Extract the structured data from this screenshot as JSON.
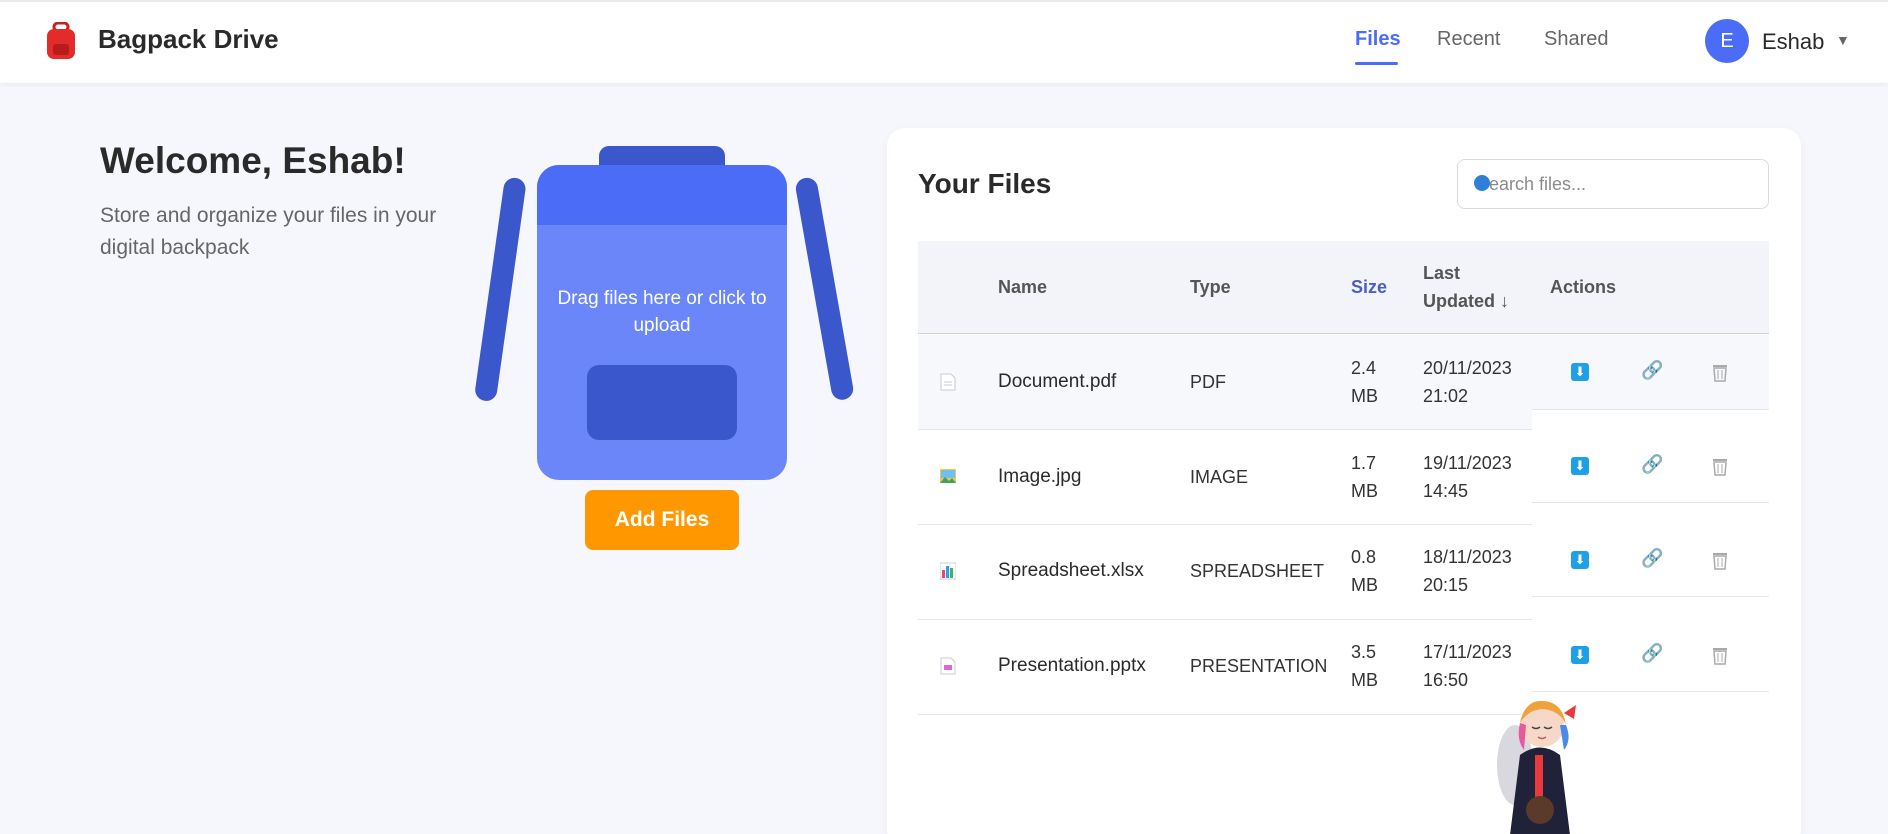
{
  "app": {
    "name": "Bagpack Drive"
  },
  "nav": {
    "items": [
      "Files",
      "Recent",
      "Shared"
    ],
    "active": "Files"
  },
  "user": {
    "initial": "E",
    "name": "Eshab"
  },
  "welcome": {
    "title": "Welcome, Eshab!",
    "subtitle": "Store and organize your files in your digital backpack"
  },
  "upload": {
    "drop_text": "Drag files here or click to upload",
    "button_label": "Add Files"
  },
  "files_panel": {
    "title": "Your Files",
    "search_placeholder": "Search files...",
    "columns": {
      "name": "Name",
      "type": "Type",
      "size": "Size",
      "last_updated_1": "Last",
      "last_updated_2": "Updated ↓",
      "actions": "Actions"
    },
    "rows": [
      {
        "icon": "pdf-file-icon",
        "name": "Document.pdf",
        "type": "PDF",
        "size_1": "2.4",
        "size_2": "MB",
        "date": "20/11/2023",
        "time": "21:02"
      },
      {
        "icon": "image-file-icon",
        "name": "Image.jpg",
        "type": "IMAGE",
        "size_1": "1.7",
        "size_2": "MB",
        "date": "19/11/2023",
        "time": "14:45"
      },
      {
        "icon": "spreadsheet-file-icon",
        "name": "Spreadsheet.xlsx",
        "type": "SPREADSHEET",
        "size_1": "0.8",
        "size_2": "MB",
        "date": "18/11/2023",
        "time": "20:15"
      },
      {
        "icon": "presentation-file-icon",
        "name": "Presentation.pptx",
        "type": "PRESENTATION",
        "size_1": "3.5",
        "size_2": "MB",
        "date": "17/11/2023",
        "time": "16:50"
      }
    ]
  },
  "colors": {
    "accent": "#4a6cf7",
    "button": "#ff9800",
    "download": "#1ea0e6"
  }
}
